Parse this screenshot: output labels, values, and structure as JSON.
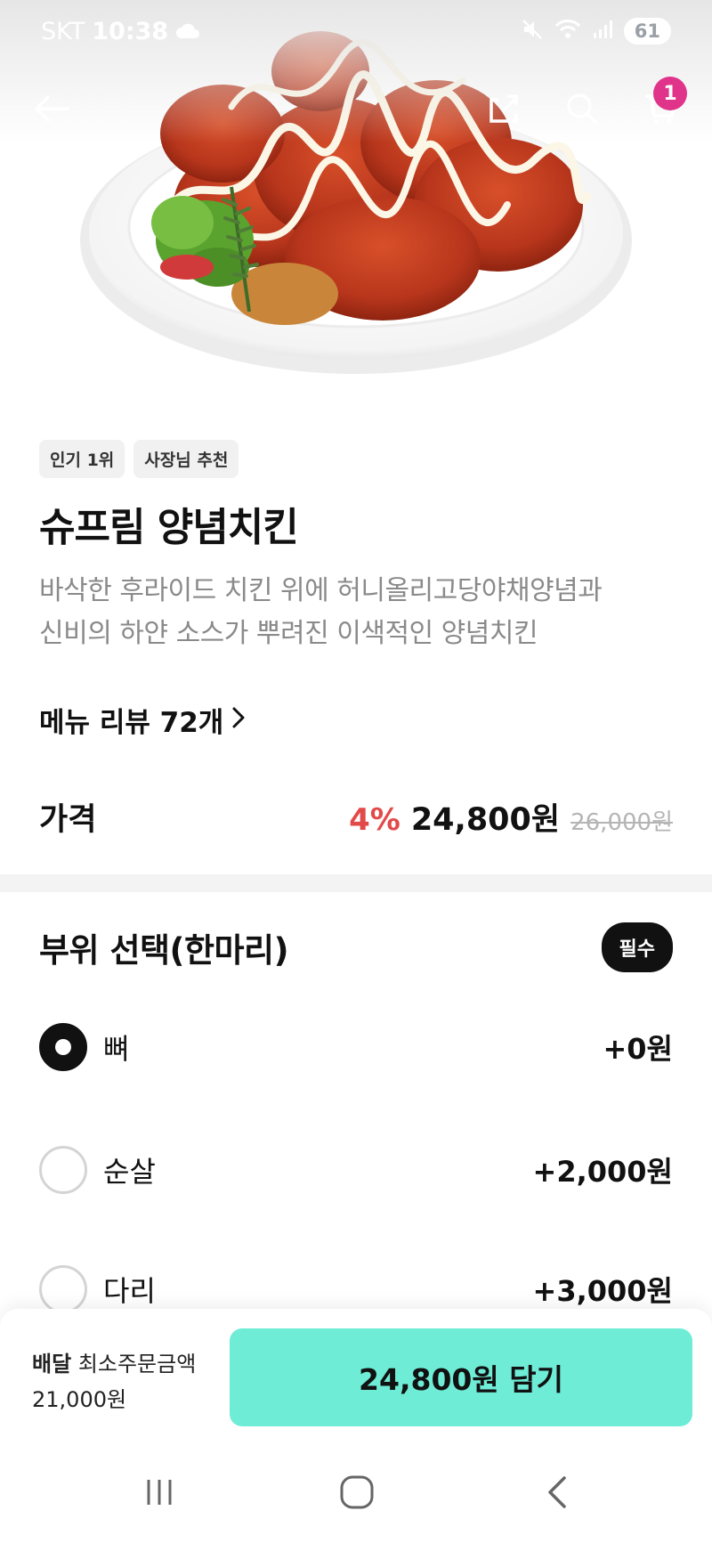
{
  "status_bar": {
    "carrier": "SKT",
    "time": "10:38",
    "battery": "61",
    "icons": [
      "cloud-icon",
      "mute-icon",
      "wifi-icon",
      "signal-icon",
      "battery-icon"
    ]
  },
  "top_nav": {
    "icons": [
      "back-arrow-icon",
      "share-icon",
      "search-icon",
      "cart-icon"
    ],
    "cart_count": "1"
  },
  "hero": {
    "image": "chicken-dish-image"
  },
  "tags": [
    "인기 1위",
    "사장님 추천"
  ],
  "menu": {
    "title": "슈프림 양념치킨",
    "description_line1": "바삭한 후라이드 치킨 위에 허니올리고당야채양념과",
    "description_line2": "신비의 하얀 소스가 뿌려진 이색적인 양념치킨",
    "review_link": "메뉴 리뷰 72개"
  },
  "price": {
    "label": "가격",
    "discount": "4%",
    "current": "24,800원",
    "original": "26,000원"
  },
  "option_group": {
    "title": "부위 선택(한마리)",
    "required": "필수",
    "options": [
      {
        "label": "뼈",
        "price": "+0원",
        "selected": true
      },
      {
        "label": "순살",
        "price": "+2,000원",
        "selected": false
      },
      {
        "label": "다리",
        "price": "+3,000원",
        "selected": false
      }
    ]
  },
  "bottom_bar": {
    "delivery_label": "배달",
    "min_order_label": "최소주문금액",
    "min_order_value": "21,000원",
    "add_button": "24,800원 담기"
  },
  "system_nav": {
    "icons": [
      "recent-apps-icon",
      "home-icon",
      "back-icon"
    ]
  },
  "colors": {
    "accent": "#6eecd6",
    "discount": "#e24a4a",
    "badge": "#e0338a"
  }
}
